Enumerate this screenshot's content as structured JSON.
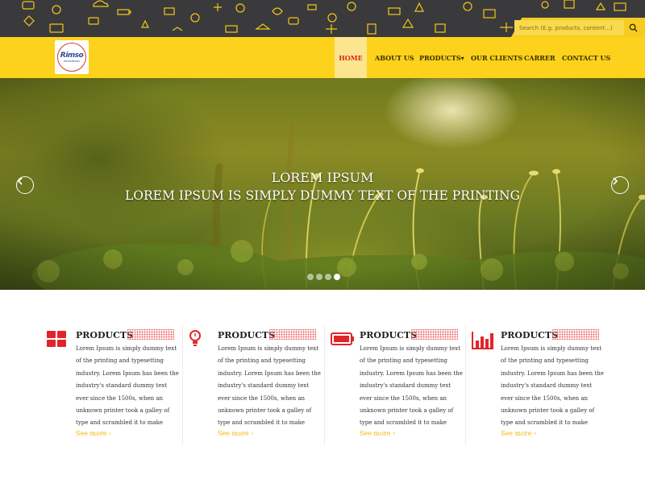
{
  "search": {
    "placeholder": "Search (E.g. products, content...)"
  },
  "logo": {
    "text": "Rimso",
    "sub": "ENTERPRISES"
  },
  "nav": {
    "items": [
      {
        "label": "HOME",
        "active": true
      },
      {
        "label": "ABOUT US"
      },
      {
        "label": "PRODUCTS▾"
      },
      {
        "label": "OUR CLIENTS"
      },
      {
        "label": "CARRER"
      },
      {
        "label": "CONTACT US"
      }
    ]
  },
  "hero": {
    "title": "LOREM IPSUM",
    "subtitle": "LOREM IPSUM IS SIMPLY DUMMY TEXT OF THE PRINTING",
    "slide_count": 4,
    "active_slide": 4
  },
  "features": [
    {
      "icon": "grid-icon",
      "title": "PRODUCTS",
      "body": "Lorem Ipsum is simply dummy text of the printing and typesetting industry. Lorem Ipsum has been the industry's standard dummy text ever since the 1500s, when an unknown printer took a galley of type and scrambled it to make",
      "more": "See more ›"
    },
    {
      "icon": "lightbulb-icon",
      "title": "PRODUCTS",
      "body": "Lorem Ipsum is simply dummy text of the printing and typesetting industry. Lorem Ipsum has been the industry's standard dummy text ever since the 1500s, when an unknown printer took a galley of type and scrambled it to make",
      "more": "See more ›"
    },
    {
      "icon": "battery-icon",
      "title": "PRODUCTS",
      "body": "Lorem Ipsum is simply dummy text of the printing and typesetting industry. Lorem Ipsum has been the industry's standard dummy text ever since the 1500s, when an unknown printer took a galley of type and scrambled it to make",
      "more": "See more ›"
    },
    {
      "icon": "bar-chart-icon",
      "title": "PRODUCTS",
      "body": "Lorem Ipsum is simply dummy text of the printing and typesetting industry. Lorem Ipsum has been the industry's standard dummy text ever since the 1500s, when an unknown printer took a galley of type and scrambled it to make",
      "more": "See more ›"
    }
  ],
  "colors": {
    "accent": "#fcd21c",
    "dark": "#3a3a3c",
    "icon_red": "#e0252a",
    "link": "#f2b600"
  }
}
